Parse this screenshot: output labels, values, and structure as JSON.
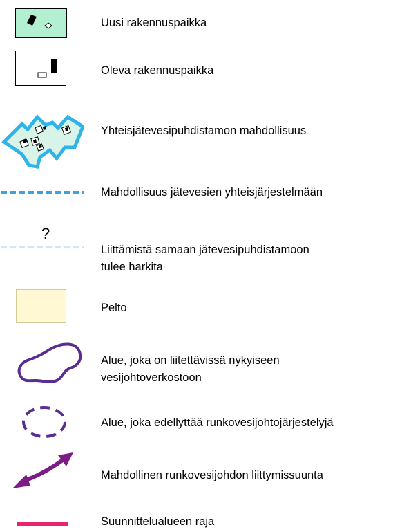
{
  "legend": {
    "items": [
      {
        "id": "new-plot",
        "label": "Uusi rakennuspaikka"
      },
      {
        "id": "existing-plot",
        "label": "Oleva rakennuspaikka"
      },
      {
        "id": "shared-treatment",
        "label": "Yhteisjätevesipuhdistamon mahdollisuus"
      },
      {
        "id": "joint-system",
        "label": "Mahdollisuus jätevesien yhteisjärjestelmään"
      },
      {
        "id": "connection-considered",
        "label_line1": "Liittämistä samaan jätevesipuhdistamoon",
        "label_line2": "tulee harkita",
        "mark": "?"
      },
      {
        "id": "field",
        "label": "Pelto"
      },
      {
        "id": "connectable-area",
        "label_line1": "Alue, joka on liitettävissä nykyiseen",
        "label_line2": "vesijohtoverkostoon"
      },
      {
        "id": "trunk-required-area",
        "label": "Alue, joka edellyttää runkovesijohtojärjestelyjä"
      },
      {
        "id": "trunk-direction",
        "label": "Mahdollinen runkovesijohdon liittymissuunta"
      },
      {
        "id": "plan-boundary",
        "label": "Suunnittelualueen raja"
      }
    ]
  },
  "colors": {
    "new_plot_fill": "#b3f0d2",
    "shared_area_outline": "#2fb3e8",
    "shared_area_fill": "#d8f3e8",
    "dashed_line": "#3aa5dd",
    "field_fill": "#fff8d2",
    "field_border": "#d2cc9a",
    "purple_line": "#5a2d91",
    "purple_arrow": "#7c1c86",
    "boundary": "#e8246c"
  }
}
